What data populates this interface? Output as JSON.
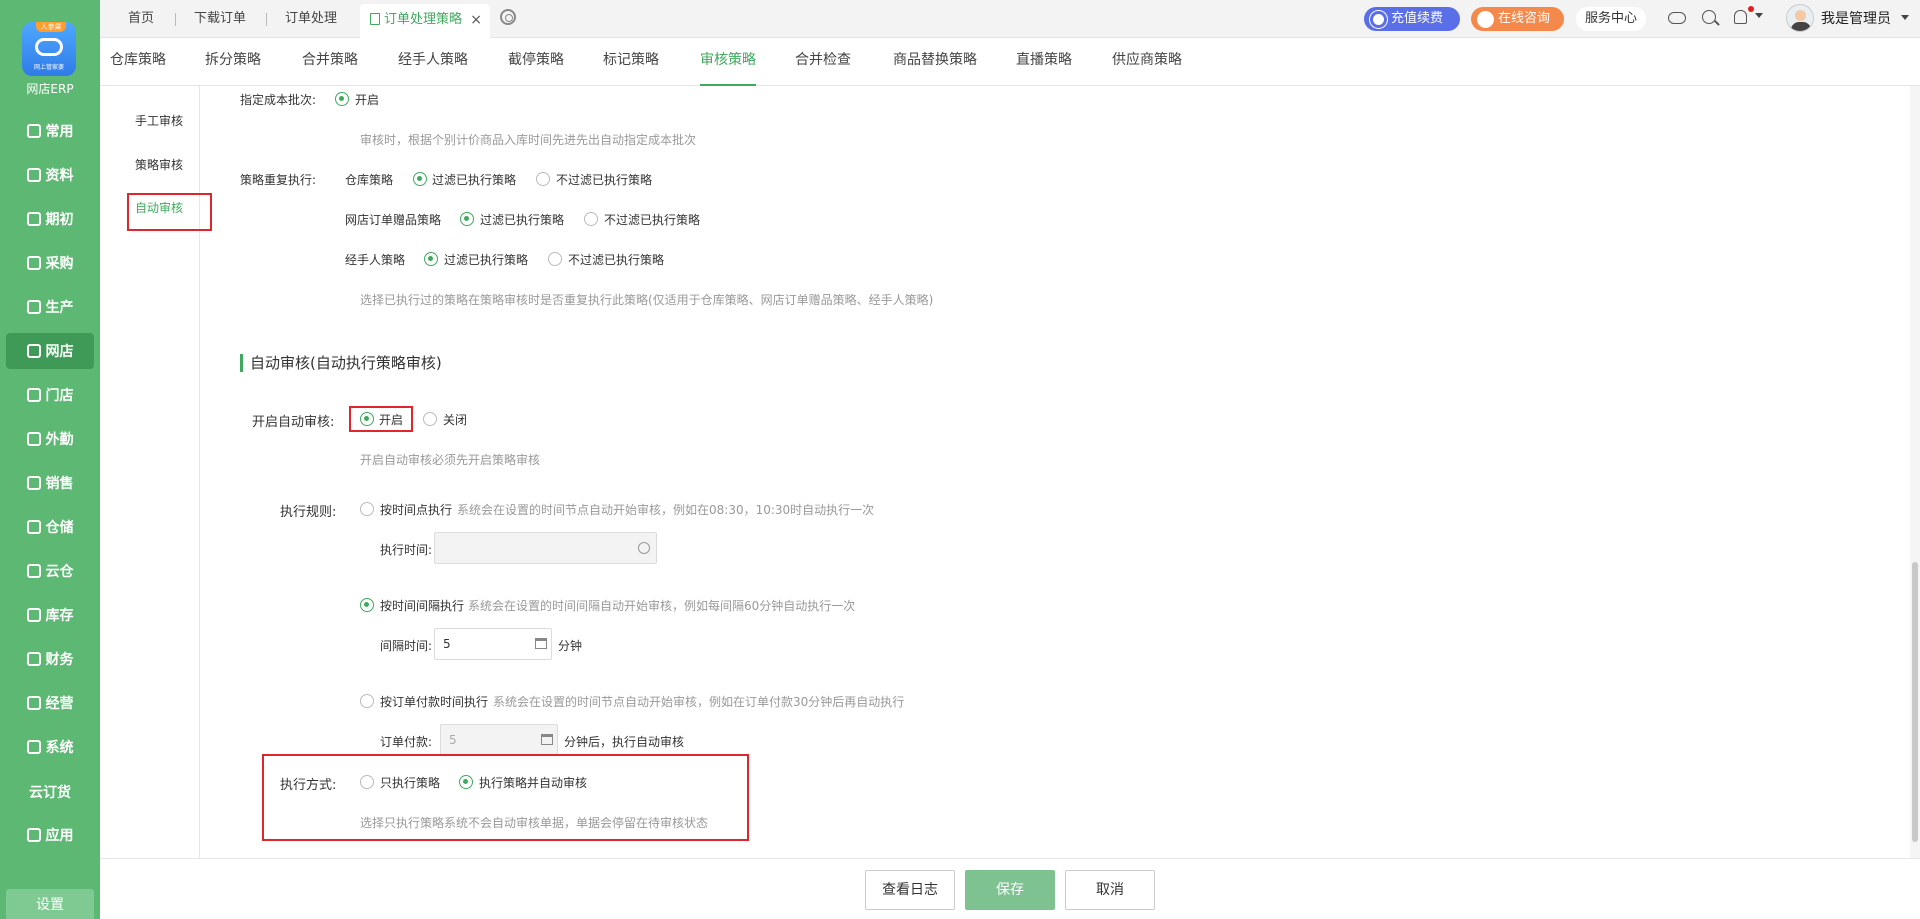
{
  "app": {
    "logo_badge": "人参果",
    "logo_caption": "网上管家婆",
    "title": "网店ERP",
    "accent": "#5cb873",
    "active_color": "#3faa5e"
  },
  "left_nav": {
    "items": [
      {
        "label": "常用",
        "icon": "star-icon"
      },
      {
        "label": "资料",
        "icon": "document-icon"
      },
      {
        "label": "期初",
        "icon": "target-icon"
      },
      {
        "label": "采购",
        "icon": "purchase-icon"
      },
      {
        "label": "生产",
        "icon": "production-icon"
      },
      {
        "label": "网店",
        "icon": "store-icon"
      },
      {
        "label": "门店",
        "icon": "pie-icon"
      },
      {
        "label": "外勤",
        "icon": "compass-icon"
      },
      {
        "label": "销售",
        "icon": "bar-chart-icon"
      },
      {
        "label": "仓储",
        "icon": "warehouse-icon"
      },
      {
        "label": "云仓",
        "icon": "cloud-warehouse-icon"
      },
      {
        "label": "库存",
        "icon": "house-icon"
      },
      {
        "label": "财务",
        "icon": "finance-icon"
      },
      {
        "label": "经营",
        "icon": "operation-icon"
      },
      {
        "label": "系统",
        "icon": "gear-icon"
      },
      {
        "label": "云订货",
        "icon": ""
      },
      {
        "label": "应用",
        "icon": "plus-icon"
      }
    ],
    "active_index": 5,
    "settings_label": "设置"
  },
  "top_tabs": {
    "items": [
      "首页",
      "下载订单",
      "订单处理"
    ],
    "active_tab": "订单处理策略",
    "close_glyph": "×"
  },
  "header_actions": {
    "renew": "充值续费",
    "consult": "在线咨询",
    "service": "服务中心",
    "user": "我是管理员"
  },
  "sub_tabs": {
    "items": [
      "仓库策略",
      "拆分策略",
      "合并策略",
      "经手人策略",
      "截停策略",
      "标记策略",
      "审核策略",
      "合并检查",
      "商品替换策略",
      "直播策略",
      "供应商策略"
    ],
    "active_index": 6
  },
  "side_menu": {
    "items": [
      "手工审核",
      "策略审核",
      "自动审核"
    ],
    "active_index": 2
  },
  "content": {
    "cost_batch": {
      "label": "指定成本批次:",
      "option_on": "开启",
      "hint": "审核时，根据个别计价商品入库时间先进先出自动指定成本批次"
    },
    "repeat_exec": {
      "label": "策略重复执行:",
      "rows": [
        {
          "name": "仓库策略",
          "opt1": "过滤已执行策略",
          "opt2": "不过滤已执行策略",
          "selected": 1
        },
        {
          "name": "网店订单赠品策略",
          "opt1": "过滤已执行策略",
          "opt2": "不过滤已执行策略",
          "selected": 1
        },
        {
          "name": "经手人策略",
          "opt1": "过滤已执行策略",
          "opt2": "不过滤已执行策略",
          "selected": 1
        }
      ],
      "hint": "选择已执行过的策略在策略审核时是否重复执行此策略(仅适用于仓库策略、网店订单赠品策略、经手人策略)"
    },
    "section_title": "自动审核(自动执行策略审核)",
    "auto_audit": {
      "label": "开启自动审核:",
      "on": "开启",
      "off": "关闭",
      "selected": "on",
      "hint": "开启自动审核必须先开启策略审核"
    },
    "exec_rule": {
      "label": "执行规则:",
      "by_time": {
        "title": "按时间点执行",
        "desc": "系统会在设置的时间节点自动开始审核，例如在08:30，10:30时自动执行一次",
        "field_label": "执行时间:",
        "value": ""
      },
      "by_interval": {
        "title": "按时间间隔执行",
        "desc": "系统会在设置的时间间隔自动开始审核，例如每间隔60分钟自动执行一次",
        "field_label": "间隔时间:",
        "value": "5",
        "unit": "分钟"
      },
      "by_payment": {
        "title": "按订单付款时间执行",
        "desc": "系统会在设置的时间节点自动开始审核，例如在订单付款30分钟后再自动执行",
        "field_label": "订单付款:",
        "value": "5",
        "unit": "分钟后，执行自动审核"
      },
      "selected": "by_interval"
    },
    "exec_mode": {
      "label": "执行方式:",
      "opt1": "只执行策略",
      "opt2": "执行策略并自动审核",
      "selected": 2,
      "hint": "选择只执行策略系统不会自动审核单据，单据会停留在待审核状态"
    }
  },
  "footer": {
    "log": "查看日志",
    "save": "保存",
    "cancel": "取消"
  }
}
